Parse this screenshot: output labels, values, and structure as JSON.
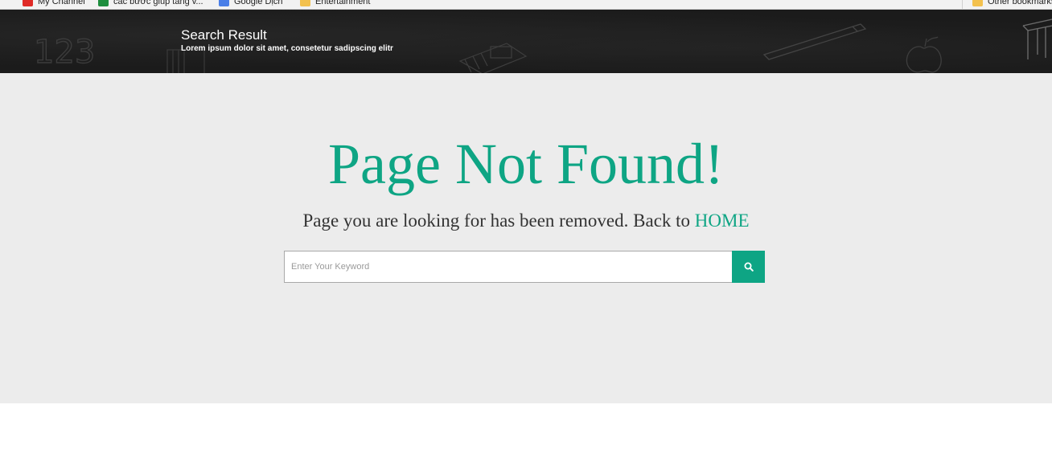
{
  "browser": {
    "bookmarks": [
      {
        "label": "My Channel",
        "color": "#e02b27"
      },
      {
        "label": "cac bước giúp tăng v...",
        "color": "#1e8e3e"
      },
      {
        "label": "Google Dịch",
        "color": "#4a7fe8"
      },
      {
        "label": "Entertainment",
        "color": "#f3c14e"
      }
    ],
    "other_bookmarks": {
      "label": "Other bookmarks",
      "color": "#f3c14e"
    }
  },
  "header": {
    "title": "Search Result",
    "subtitle": "Lorem ipsum dolor sit amet, consetetur sadipscing elitr",
    "chalk_numbers": "123"
  },
  "main": {
    "heading": "Page Not Found!",
    "message_prefix": "Page you are looking for has been removed. Back to ",
    "home_link": "HOME",
    "search": {
      "placeholder": "Enter Your Keyword",
      "value": "",
      "button_icon": "search-icon"
    }
  },
  "colors": {
    "accent": "#0ea584",
    "header_bg": "#1b1b1b",
    "main_bg": "#ececec"
  }
}
